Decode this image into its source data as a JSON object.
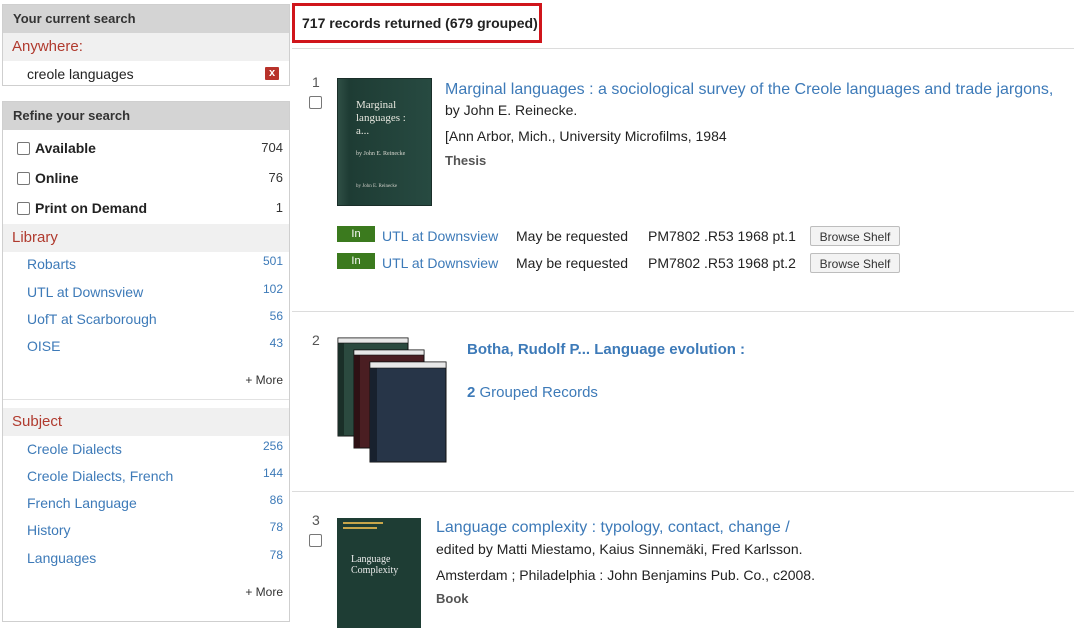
{
  "sidebar": {
    "current_search": {
      "heading": "Your current search",
      "field_label": "Anywhere:",
      "term": "creole languages",
      "remove_glyph": "x"
    },
    "refine": {
      "heading": "Refine your search",
      "availability": [
        {
          "label": "Available",
          "count": "704"
        },
        {
          "label": "Online",
          "count": "76"
        },
        {
          "label": "Print on Demand",
          "count": "1"
        }
      ],
      "library": {
        "heading": "Library",
        "items": [
          {
            "label": "Robarts",
            "count": "501"
          },
          {
            "label": "UTL at Downsview",
            "count": "102"
          },
          {
            "label": "UofT at Scarborough",
            "count": "56"
          },
          {
            "label": "OISE",
            "count": "43"
          }
        ],
        "more": "+ More"
      },
      "subject": {
        "heading": "Subject",
        "items": [
          {
            "label": "Creole Dialects",
            "count": "256"
          },
          {
            "label": "Creole Dialects, French",
            "count": "144"
          },
          {
            "label": "French Language",
            "count": "86"
          },
          {
            "label": "History",
            "count": "78"
          },
          {
            "label": "Languages",
            "count": "78"
          }
        ],
        "more": "+ More"
      }
    }
  },
  "results": {
    "count_text": "717 records returned (679 grouped)",
    "records": [
      {
        "number": "1",
        "title": "Marginal languages : a sociological survey of the Creole languages and trade jargons,",
        "author": "by John E. Reinecke.",
        "publication": "[Ann Arbor, Mich., University Microfilms, 1984",
        "format": "Thesis",
        "cover_text": {
          "title": "Marginal languages : a...",
          "author": "by John E. Reinecke",
          "author2": "by John E. Reinecke"
        },
        "holdings": [
          {
            "status": "In",
            "location": "UTL at Downsview",
            "note": "May be requested",
            "call_number": "PM7802 .R53 1968 pt.1",
            "button": "Browse Shelf"
          },
          {
            "status": "In",
            "location": "UTL at Downsview",
            "note": "May be requested",
            "call_number": "PM7802 .R53 1968 pt.2",
            "button": "Browse Shelf"
          }
        ]
      },
      {
        "number": "2",
        "title": "Botha, Rudolf P... Language evolution :",
        "grouped_count": "2",
        "grouped_label": "Grouped Records"
      },
      {
        "number": "3",
        "title": "Language complexity : typology, contact, change /",
        "author": "edited by Matti Miestamo, Kaius Sinnemäki, Fred Karlsson.",
        "publication": "Amsterdam ; Philadelphia : John Benjamins Pub. Co., c2008.",
        "format": "Book",
        "cover_text": {
          "title": "Language Complexity"
        }
      }
    ]
  },
  "colors": {
    "link": "#3d7ab8",
    "section_heading": "#b03a2e",
    "status_in": "#3b7a1e",
    "highlight_border": "#d0151b"
  }
}
